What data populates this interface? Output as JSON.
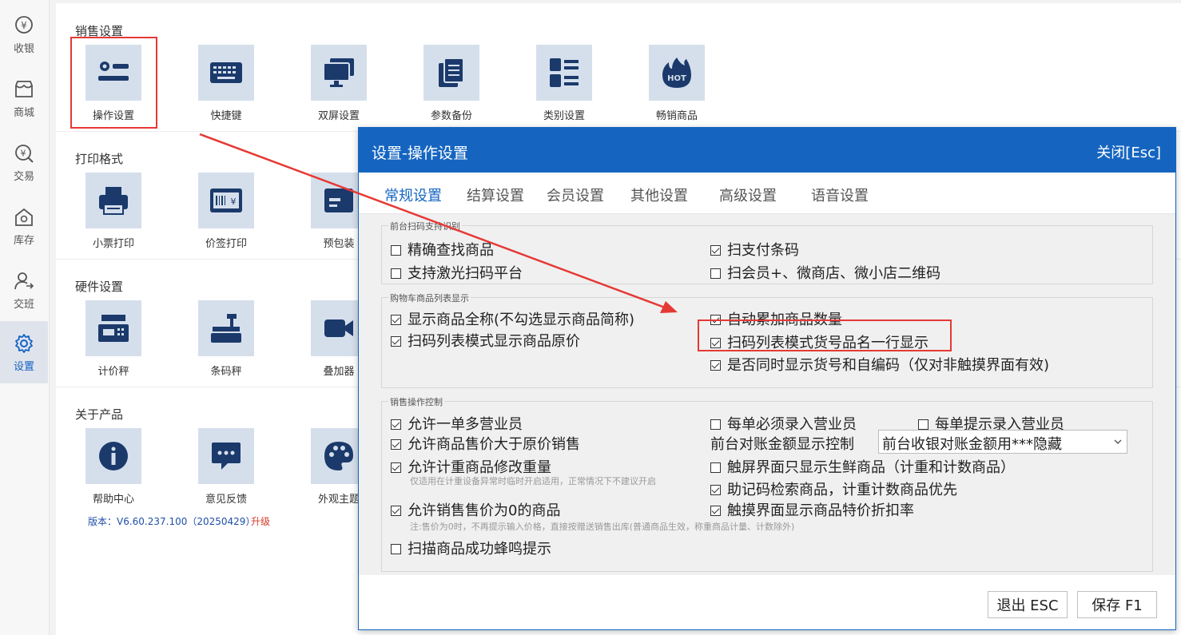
{
  "nav": [
    {
      "label": "收银",
      "icon": "cashier-icon"
    },
    {
      "label": "商城",
      "icon": "store-icon"
    },
    {
      "label": "交易",
      "icon": "transaction-icon"
    },
    {
      "label": "库存",
      "icon": "inventory-icon"
    },
    {
      "label": "交班",
      "icon": "shift-icon"
    },
    {
      "label": "设置",
      "icon": "gear-icon",
      "active": true
    }
  ],
  "sections": [
    {
      "title": "销售设置",
      "tiles": [
        "操作设置",
        "快捷键",
        "双屏设置",
        "参数备份",
        "类别设置",
        "畅销商品"
      ]
    },
    {
      "title": "打印格式",
      "tiles": [
        "小票打印",
        "价签打印",
        "预包装"
      ]
    },
    {
      "title": "硬件设置",
      "tiles": [
        "计价秤",
        "条码秤",
        "叠加器"
      ]
    },
    {
      "title": "关于产品",
      "tiles": [
        "帮助中心",
        "意见反馈",
        "外观主题"
      ]
    }
  ],
  "hot_badge": "HOT",
  "version": "版本：V6.60.237.100（20250429）",
  "upgrade": "升级",
  "dialog": {
    "title": "设置-操作设置",
    "close": "关闭[Esc]",
    "tabs": [
      "常规设置",
      "结算设置",
      "会员设置",
      "其他设置",
      "高级设置",
      "语音设置"
    ],
    "groups": [
      {
        "title": "前台扫码支持识别"
      },
      {
        "title": "购物车商品列表显示"
      },
      {
        "title": "销售操作控制"
      }
    ],
    "options": {
      "o1": "精确查找商品",
      "o2": "扫支付条码",
      "o3": "支持激光扫码平台",
      "o4": "扫会员+、微商店、微小店二维码",
      "o5": "显示商品全称(不勾选显示商品简称)",
      "o6": "自动累加商品数量",
      "o7": "扫码列表模式显示商品原价",
      "o8": "扫码列表模式货号品名一行显示",
      "o9": "是否同时显示货号和自编码（仅对非触摸界面有效)",
      "o10": "允许一单多营业员",
      "o11": "每单必须录入营业员",
      "o12": "每单提示录入营业员",
      "o13": "允许商品售价大于原价销售",
      "o14": "允许计重商品修改重量",
      "o15": "触屏界面只显示生鲜商品（计重和计数商品）",
      "o16": "助记码检索商品，计重计数商品优先",
      "o17": "允许销售售价为0的商品",
      "o18": "触摸界面显示商品特价折扣率",
      "o19": "扫描商品成功蜂鸣提示"
    },
    "note1": "仅适用在计重设备异常时临时开启适用，正常情况下不建议开启",
    "note2": "注:售价为0时，不再提示输入价格，直接按赠送销售出库(普通商品生效，称重商品计量、计数除外)",
    "amount_label": "前台对账金额显示控制",
    "amount_select": "前台收银对账金额用***隐藏",
    "exit_btn": "退出 ESC",
    "save_btn": "保存 F1"
  }
}
